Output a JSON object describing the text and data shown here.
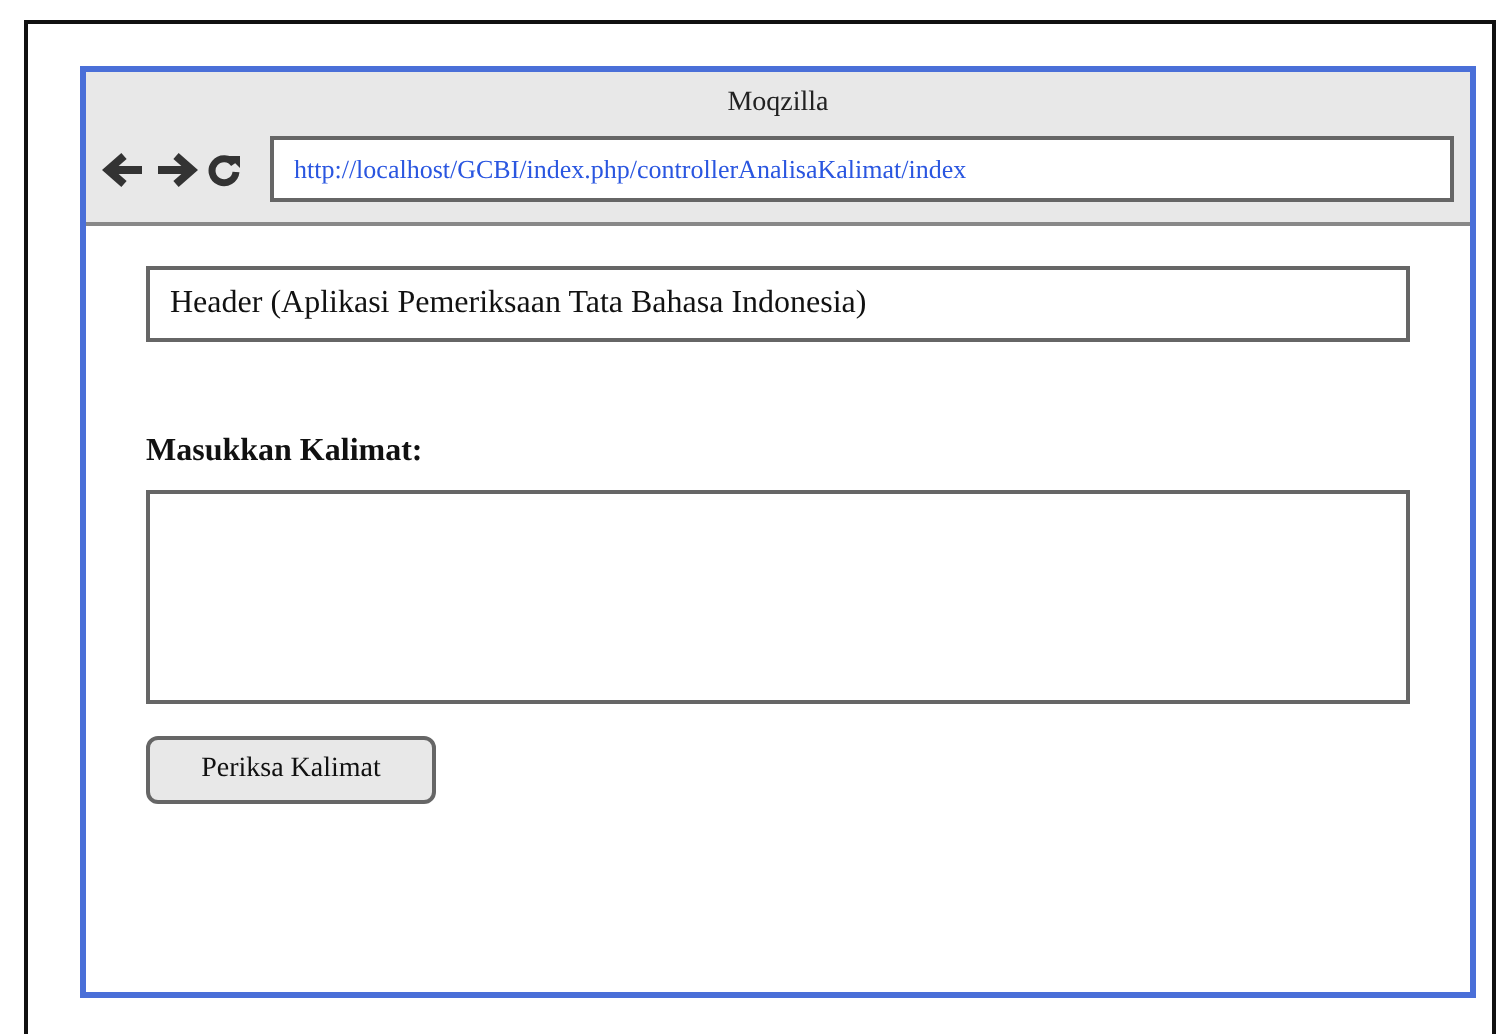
{
  "window": {
    "title": "Moqzilla"
  },
  "address_bar": {
    "url": "http://localhost/GCBI/index.php/controllerAnalisaKalimat/index"
  },
  "header": {
    "text": "Header (Aplikasi Pemeriksaan Tata Bahasa Indonesia)"
  },
  "input_label": "Masukkan Kalimat:",
  "button": "Periksa Kalimat"
}
